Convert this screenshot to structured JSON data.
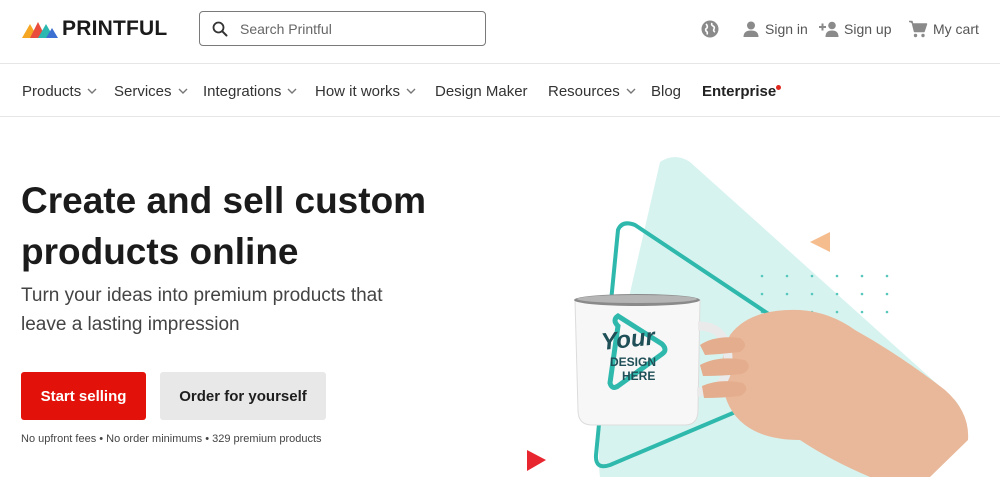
{
  "header": {
    "logo_text": "PRINTFUL",
    "search": {
      "placeholder": "Search Printful"
    },
    "account": {
      "sign_in": "Sign in",
      "sign_up": "Sign up",
      "cart": "My cart"
    }
  },
  "nav": {
    "items": [
      {
        "label": "Products",
        "dropdown": true
      },
      {
        "label": "Services",
        "dropdown": true
      },
      {
        "label": "Integrations",
        "dropdown": true
      },
      {
        "label": "How it works",
        "dropdown": true
      },
      {
        "label": "Design Maker",
        "dropdown": false
      },
      {
        "label": "Resources",
        "dropdown": true
      },
      {
        "label": "Blog",
        "dropdown": false
      },
      {
        "label": "Enterprise",
        "dropdown": false,
        "new_badge": true
      }
    ]
  },
  "hero": {
    "title_line1": "Create and sell custom",
    "title_line2": "products online",
    "subtitle_line1": "Turn your ideas into premium products that",
    "subtitle_line2": "leave a lasting impression",
    "primary_button": "Start selling",
    "secondary_button": "Order for yourself",
    "fineprint": "No upfront fees • No order minimums • 329 premium products",
    "mug": {
      "line1": "Your",
      "line2": "DESIGN",
      "line3": "HERE"
    }
  },
  "colors": {
    "brand_red": "#e2120b",
    "teal": "#2fb9ad",
    "mint": "#d6f2ee",
    "orange": "#f5b88a",
    "logo_orange": "#f28c3a",
    "logo_red": "#e63b3b",
    "logo_teal": "#2bb8b0",
    "logo_blue": "#3b6fd1"
  },
  "icons": [
    "search-icon",
    "globe-icon",
    "user-icon",
    "add-user-icon",
    "cart-icon",
    "chevron-down-icon"
  ]
}
